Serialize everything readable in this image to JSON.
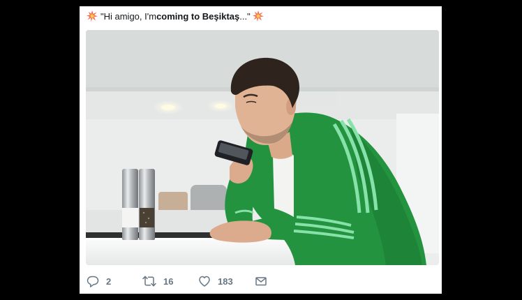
{
  "tweet": {
    "text_open": "\"Hi amigo, I'm ",
    "text_bold": "coming to Beşiktaş",
    "text_close": "...\"",
    "lead_emoji": "collision-emoji",
    "trail_emoji": "collision-emoji"
  },
  "media": {
    "alt": "photo"
  },
  "actions": {
    "reply_icon": "reply-icon",
    "reply_count": "2",
    "retweet_icon": "retweet-icon",
    "retweet_count": "16",
    "like_icon": "heart-icon",
    "like_count": "183",
    "dm_icon": "envelope-icon"
  },
  "colors": {
    "page_background": "#000000",
    "card_background": "#ffffff",
    "text": "#14171a",
    "action_gray": "#657786",
    "jacket_green": "#23933f",
    "stripe_green": "#7ee0a0"
  }
}
